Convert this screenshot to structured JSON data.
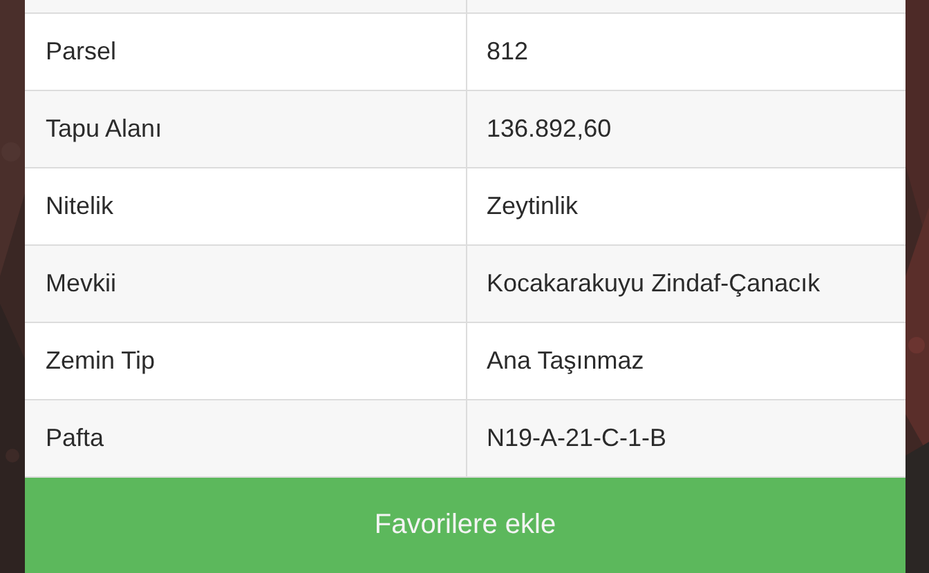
{
  "table": {
    "rows": [
      {
        "label": "Parsel",
        "value": "812"
      },
      {
        "label": "Tapu Alanı",
        "value": "136.892,60"
      },
      {
        "label": "Nitelik",
        "value": "Zeytinlik"
      },
      {
        "label": "Mevkii",
        "value": "Kocakarakuyu Zindaf-Çanacık"
      },
      {
        "label": "Zemin Tip",
        "value": "Ana Taşınmaz"
      },
      {
        "label": "Pafta",
        "value": "N19-A-21-C-1-B"
      }
    ]
  },
  "button": {
    "label": "Favorilere ekle"
  }
}
